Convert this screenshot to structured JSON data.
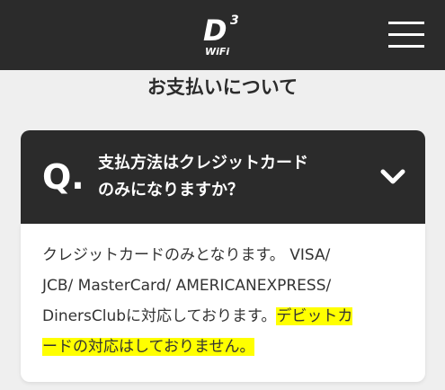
{
  "header": {
    "logo_main": "D",
    "logo_sup": "3",
    "logo_sub": "WiFi",
    "bg_color": "#2b2b2b",
    "menu_icon": "hamburger-menu-icon"
  },
  "page": {
    "title": "お支払いについて"
  },
  "faq": {
    "q_mark": "Q.",
    "question_line1": "支払方法はクレジットカード",
    "question_line2": "のみになりますか？",
    "toggle_icon": "chevron-down-icon",
    "answer_line1": "クレジットカードのみとなります。 VISA/",
    "answer_line2": "JCB/ MasterCard/ AMERICANEXPRESS/",
    "answer_line3_plain": "DinersClubに対応しております。",
    "answer_line3_highlight": "デビットカ",
    "answer_line4_highlight": "ードの対応はしておりません。",
    "highlight_color": "#ffff00"
  }
}
